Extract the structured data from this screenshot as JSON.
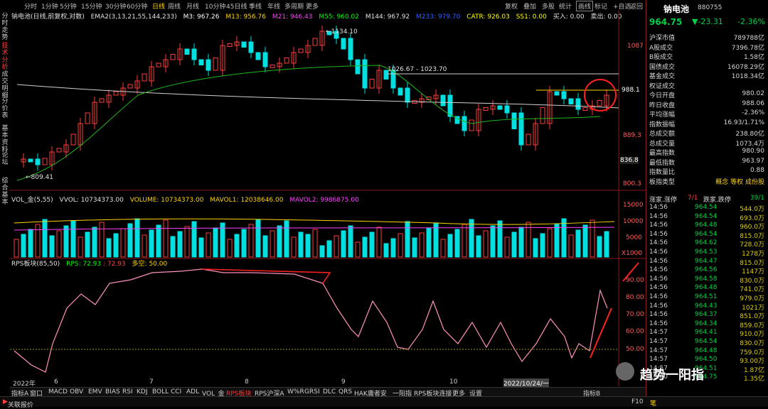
{
  "periods": [
    "分时",
    "1分钟",
    "5分钟",
    "15分钟",
    "30分钟",
    "60分钟",
    "日线",
    "周线",
    "月线",
    "10分钟",
    "45日线",
    "季线",
    "年线",
    "多周期",
    "更多"
  ],
  "active_period": "日线",
  "right_tools": [
    "复权",
    "叠加",
    "多股",
    "统计",
    "画线",
    "标记",
    "+自选",
    "返回"
  ],
  "left_nav": [
    "分时走势",
    "技术分析",
    "成交明细",
    "分价表",
    "基本资料",
    "论坛",
    "综合基本"
  ],
  "main_legend": {
    "name": "钠电池(日线,前复权,对数)",
    "ema": "EMA2(3,13,21,55,144,233)",
    "m3": "M3: 967.26",
    "m13": "M13: 956.76",
    "m21": "M21: 946.43",
    "m55": "M55: 960.02",
    "m144": "M144: 967.92",
    "m233": "M233: 979.70",
    "catr": "CATR: 926.03",
    "ss1": "SS1: 0.00",
    "buy": "买入: 0.00",
    "sell": "卖出: 0.00"
  },
  "price_annotations": {
    "high": "1134.10",
    "low": "809.41",
    "range": "1026.67 - 1023.70"
  },
  "price_axis": [
    "1087",
    "988.1",
    "889.3",
    "836.8",
    "800.3"
  ],
  "vol_legend": {
    "name": "VOL_金(5,55)",
    "vvol": "VVOL: 10734373.00",
    "volume": "VOLUME: 10734373.00",
    "mavol1": "MAVOL1: 12038646.00",
    "mavol2": "MAVOL2: 9986875.00"
  },
  "vol_axis": [
    "15000",
    "10000",
    "5000",
    "X1000"
  ],
  "rps_legend": {
    "name": "RPS板块(85,50)",
    "rps": "RPS: 72.93",
    "rps2": ": 72.93",
    "bull": "多空: 50.00"
  },
  "rps_axis": [
    "90.00",
    "80.00",
    "70.00",
    "60.00",
    "50.00"
  ],
  "months": [
    "2022年",
    "6",
    "7",
    "8",
    "9",
    "10",
    "2022/10/24/一"
  ],
  "right_panel": {
    "title": "钠电池",
    "code": "880755",
    "price": "964.75",
    "change": "▼-23.31",
    "pct": "-2.36%",
    "stats": [
      {
        "k": "沪深市值",
        "v": "789788亿"
      },
      {
        "k": "A股成交",
        "v": "7396.78亿"
      },
      {
        "k": "B股成交",
        "v": "1.58亿"
      },
      {
        "k": "国债成交",
        "v": "16078.29亿"
      },
      {
        "k": "基金成交",
        "v": "1018.34亿"
      },
      {
        "k": "权证成交",
        "v": ""
      },
      {
        "k": "今日开盘",
        "v": "980.02"
      },
      {
        "k": "昨日收盘",
        "v": "988.06"
      },
      {
        "k": "平均涨幅",
        "v": "-2.36%"
      },
      {
        "k": "指数振幅",
        "v": "16.93/1.71%"
      },
      {
        "k": "总成交额",
        "v": "238.80亿"
      },
      {
        "k": "总成交量",
        "v": "1073.4万"
      },
      {
        "k": "最高指数",
        "v": "980.90"
      },
      {
        "k": "最低指数",
        "v": "963.97"
      },
      {
        "k": "指数量比",
        "v": "0.88"
      },
      {
        "k": "板指类型",
        "v": "概念 等权 成份股"
      }
    ],
    "updown": {
      "up_label": "涨家.涨停",
      "up": "7/1",
      "down_label": "跌家.跌停",
      "down": "39/1"
    },
    "ticks": [
      {
        "t": "14:56",
        "p": "964.54",
        "v": "544.0万"
      },
      {
        "t": "14:56",
        "p": "964.54",
        "v": "693.0万"
      },
      {
        "t": "14:56",
        "p": "964.48",
        "v": "960.0万"
      },
      {
        "t": "14:56",
        "p": "964.54",
        "v": "815.0万"
      },
      {
        "t": "14:56",
        "p": "964.62",
        "v": "728.0万"
      },
      {
        "t": "14:56",
        "p": "964.53",
        "v": "1278万"
      },
      {
        "t": "14:56",
        "p": "964.47",
        "v": "815.0万"
      },
      {
        "t": "14:56",
        "p": "964.56",
        "v": "1147万"
      },
      {
        "t": "14:56",
        "p": "964.58",
        "v": "830.0万"
      },
      {
        "t": "14:56",
        "p": "964.48",
        "v": "741.0万"
      },
      {
        "t": "14:56",
        "p": "964.51",
        "v": "979.0万"
      },
      {
        "t": "14:56",
        "p": "964.43",
        "v": "1021万"
      },
      {
        "t": "14:56",
        "p": "964.37",
        "v": "851.0万"
      },
      {
        "t": "14:56",
        "p": "964.34",
        "v": "859.0万"
      },
      {
        "t": "14:57",
        "p": "964.41",
        "v": "910.0万"
      },
      {
        "t": "14:57",
        "p": "964.54",
        "v": "830.0万"
      },
      {
        "t": "14:57",
        "p": "964.48",
        "v": "759.0万"
      },
      {
        "t": "14:57",
        "p": "964.50",
        "v": "93.00万"
      },
      {
        "t": "14:57",
        "p": "964.51",
        "v": "1.87亿"
      },
      {
        "t": "15:00",
        "p": "964.75",
        "v": "1.35亿"
      }
    ]
  },
  "indicator_tabs": [
    "指标A",
    "窗口",
    "MACD",
    "OBV",
    "EMV",
    "BIAS",
    "RSI",
    "KDJ",
    "BOLL",
    "CCI",
    "ADL",
    "VOL_金",
    "RPS板块",
    "RPS沪深A",
    "W%R",
    "GRSI",
    "DLC",
    "QRS",
    "HAK庸者安",
    "一阳指",
    "RPS板块连接",
    "更多",
    "设置"
  ],
  "active_indicator": "RPS板块",
  "indicator_right": "指标B",
  "status": {
    "left": "关联报价",
    "right": "F10",
    "mode": "笔"
  },
  "watermark": "趋势一阳指",
  "colors": {
    "up": "#ff3d3d",
    "down": "#00e0e0",
    "green_text": "#00d048",
    "panel_border": "#8a1c1c"
  }
}
